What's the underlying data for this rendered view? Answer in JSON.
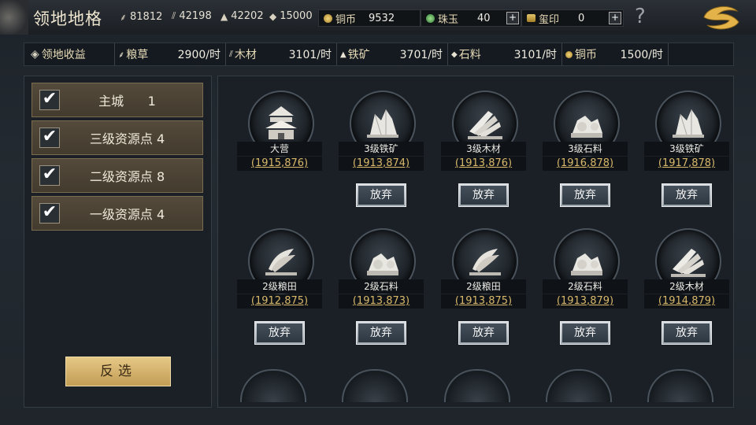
{
  "header": {
    "title": "领地地格",
    "resources": [
      {
        "icon": "grain-icon",
        "value": "81812"
      },
      {
        "icon": "wood-icon",
        "value": "42198"
      },
      {
        "icon": "iron-icon",
        "value": "42202"
      },
      {
        "icon": "stone-icon",
        "value": "15000"
      }
    ],
    "wallet": {
      "copper_label": "铜币",
      "copper_value": "9532",
      "jade_label": "珠玉",
      "jade_value": "40",
      "seal_label": "玺印",
      "seal_value": "0",
      "plus": "+"
    },
    "help": "?"
  },
  "income": {
    "title": "领地收益",
    "items": [
      {
        "label": "粮草",
        "value": "2900/时"
      },
      {
        "label": "木材",
        "value": "3101/时"
      },
      {
        "label": "铁矿",
        "value": "3701/时"
      },
      {
        "label": "石料",
        "value": "3101/时"
      },
      {
        "label": "铜币",
        "value": "1500/时"
      }
    ]
  },
  "filters": [
    {
      "label": "主城",
      "count": "1",
      "checked": "✔"
    },
    {
      "label": "三级资源点",
      "count": "4",
      "checked": "✔"
    },
    {
      "label": "二级资源点",
      "count": "8",
      "checked": "✔"
    },
    {
      "label": "一级资源点",
      "count": "4",
      "checked": "✔"
    }
  ],
  "invert_label": "反选",
  "abandon_label": "放弃",
  "tiles": [
    {
      "name": "大营",
      "coord": "(1915,876)",
      "type": "camp"
    },
    {
      "name": "3级铁矿",
      "coord": "(1913,874)",
      "type": "iron"
    },
    {
      "name": "3级木材",
      "coord": "(1913,876)",
      "type": "wood"
    },
    {
      "name": "3级石料",
      "coord": "(1916,878)",
      "type": "stone"
    },
    {
      "name": "3级铁矿",
      "coord": "(1917,878)",
      "type": "iron"
    },
    {
      "name": "2级粮田",
      "coord": "(1912,875)",
      "type": "grain"
    },
    {
      "name": "2级石料",
      "coord": "(1913,873)",
      "type": "stone"
    },
    {
      "name": "2级粮田",
      "coord": "(1913,875)",
      "type": "grain"
    },
    {
      "name": "2级石料",
      "coord": "(1913,879)",
      "type": "stone"
    },
    {
      "name": "2级木材",
      "coord": "(1914,879)",
      "type": "wood"
    }
  ]
}
